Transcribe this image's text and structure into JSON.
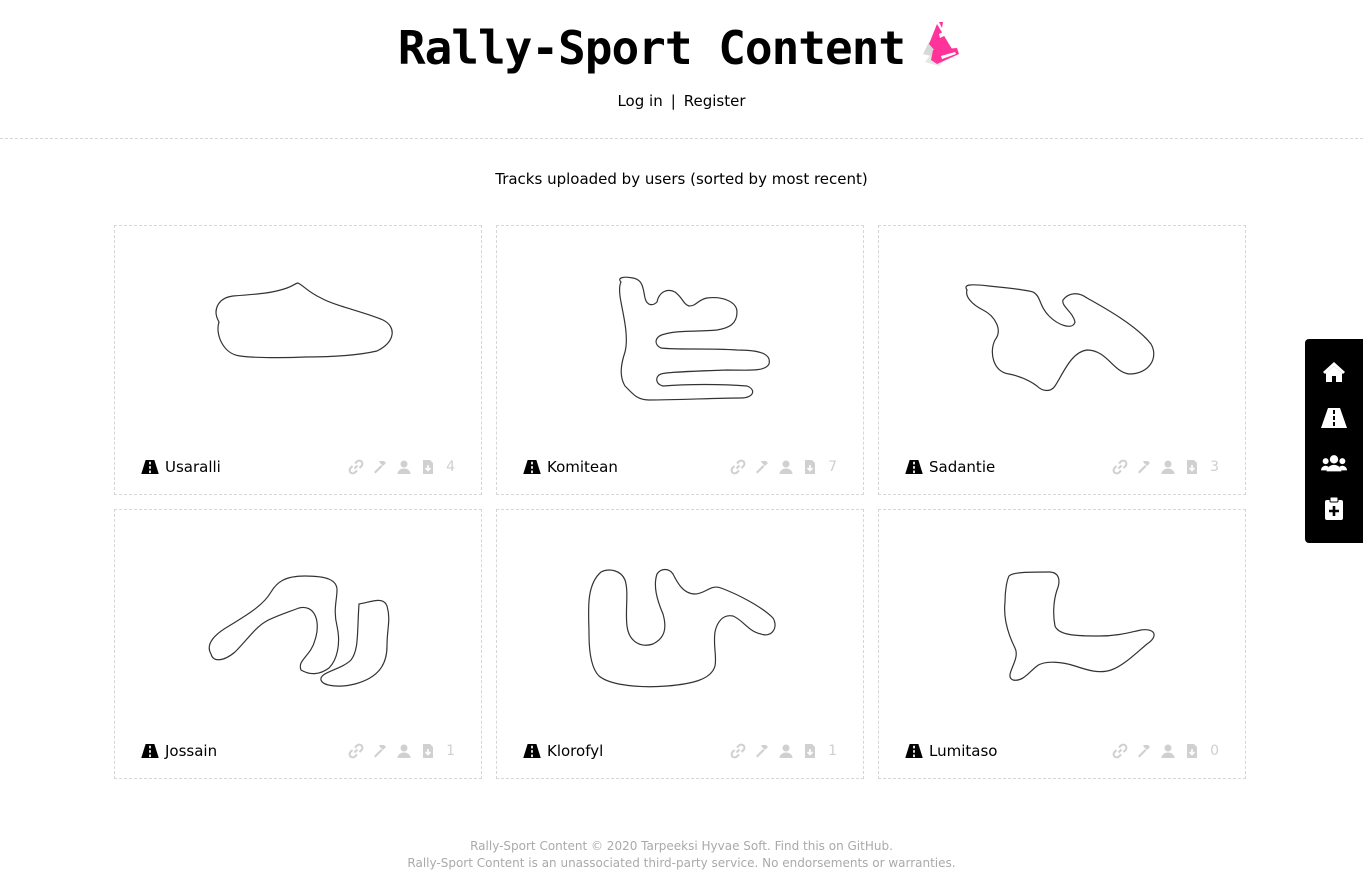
{
  "header": {
    "title": "Rally-Sport Content",
    "logo_icon": "pink-traffic-cone-icon",
    "login_label": "Log in",
    "separator": "|",
    "register_label": "Register"
  },
  "main": {
    "heading": "Tracks uploaded by users (sorted by most recent)",
    "tracks": [
      {
        "name": "Usaralli",
        "downloads": "4"
      },
      {
        "name": "Komitean",
        "downloads": "7"
      },
      {
        "name": "Sadantie",
        "downloads": "3"
      },
      {
        "name": "Jossain",
        "downloads": "1"
      },
      {
        "name": "Klorofyl",
        "downloads": "1"
      },
      {
        "name": "Lumitaso",
        "downloads": "0"
      }
    ],
    "track_meta_icons": [
      "link-icon",
      "hammer-icon",
      "user-icon",
      "file-download-icon"
    ]
  },
  "side_nav": {
    "items": [
      "home-icon",
      "road-icon",
      "users-icon",
      "clipboard-plus-icon"
    ]
  },
  "footer": {
    "line1": "Rally-Sport Content © 2020 Tarpeeksi Hyvae Soft. Find this on GitHub.",
    "line2": "Rally-Sport Content is an unassociated third-party service. No endorsements or warranties."
  },
  "colors": {
    "accent_pink": "#ff3399",
    "muted_icon": "#d0d0d0",
    "divider": "#d6d6d6",
    "side_nav_bg": "#000000"
  }
}
